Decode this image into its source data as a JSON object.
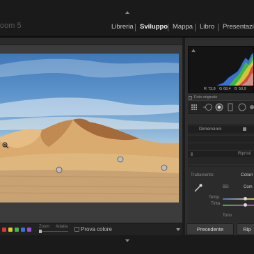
{
  "app": {
    "name": "oom 5"
  },
  "modules": [
    {
      "label": "Libreria",
      "active": false
    },
    {
      "label": "Sviluppo",
      "active": true
    },
    {
      "label": "Mappa",
      "active": false
    },
    {
      "label": "Libro",
      "active": false
    },
    {
      "label": "Presentazion",
      "active": false
    }
  ],
  "histogram": {
    "r_label": "R",
    "r_value": "73,8",
    "g_label": "G",
    "g_value": "68,4",
    "b_label": "B",
    "b_value": "50,9"
  },
  "original_photo_label": "Foto originale",
  "sub_panel": {
    "tab_label": "Dimensioni",
    "row_label": "Ripristi"
  },
  "treatment": {
    "label": "Trattamento:",
    "value": "Colori",
    "wb_label": "BB:",
    "wb_value": "Com",
    "temp_label": "Temp.",
    "tint_label": "Tinta",
    "tone_label": "Tono"
  },
  "toolbar": {
    "zoom_label": "Zoom",
    "fit_label": "Adatta",
    "soft_proof_label": "Prova colore"
  },
  "buttons": {
    "previous": "Precedente",
    "reset": "Rip"
  },
  "colors": {
    "swatches": [
      "#d63b3b",
      "#e0c43a",
      "#4ab34a",
      "#3f6fd6",
      "#9a4fd1"
    ]
  }
}
